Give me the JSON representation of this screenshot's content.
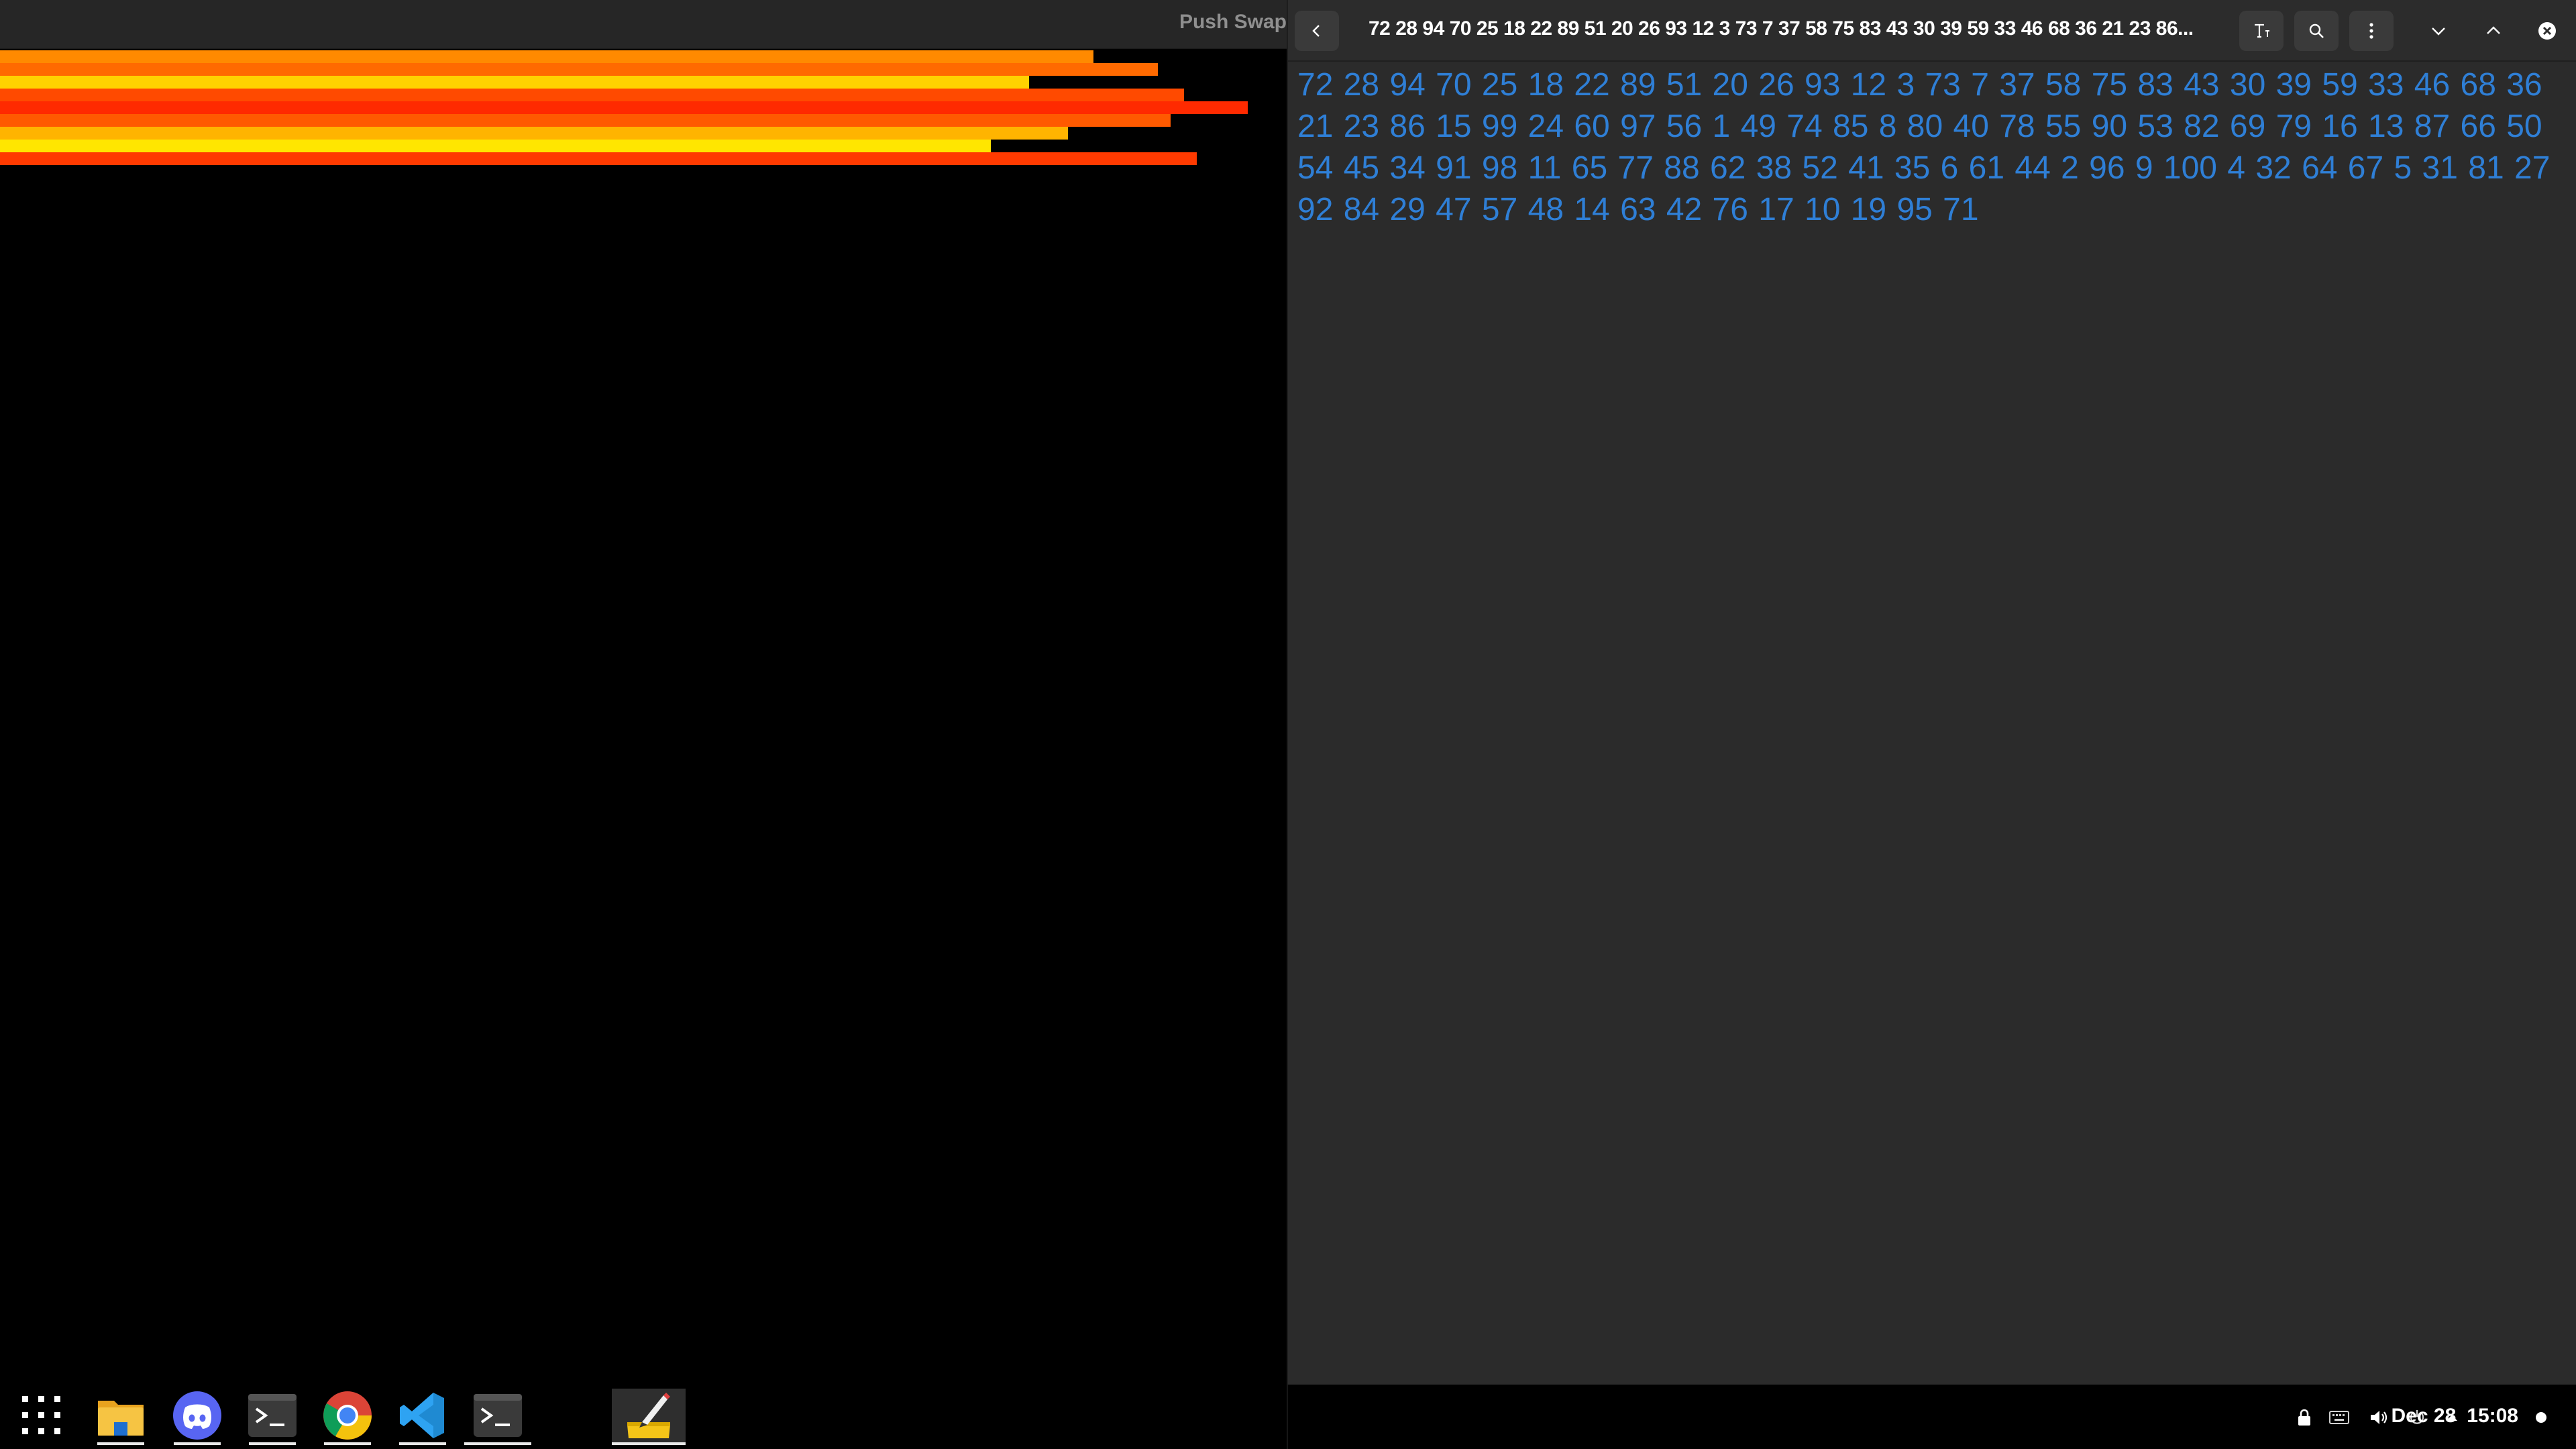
{
  "left_window": {
    "title": "Push Swap",
    "bars": [
      {
        "value": 85,
        "color": "#ff8a00"
      },
      {
        "value": 90,
        "color": "#ff6a00"
      },
      {
        "value": 80,
        "color": "#ffd200"
      },
      {
        "value": 92,
        "color": "#ff4a00"
      },
      {
        "value": 97,
        "color": "#ff2a00"
      },
      {
        "value": 91,
        "color": "#ff5a00"
      },
      {
        "value": 83,
        "color": "#ffb400"
      },
      {
        "value": 77,
        "color": "#ffe600"
      },
      {
        "value": 93,
        "color": "#ff3a00"
      }
    ]
  },
  "editor": {
    "title": "72 28 94 70 25 18 22 89 51 20 26 93 12 3 73 7 37 58 75 83 43 30 39 59 33 46 68 36 21 23 86...",
    "text": "72 28 94 70 25 18 22 89 51 20 26 93 12 3 73 7 37 58 75 83 43 30 39 59 33 46 68 36 21 23 86 15 99 24 60 97 56 1 49 74 85 8 80 40 78 55 90 53 82 69 79 16 13 87 66 50 54 45 34 91 98 11 65 77 88 62 38 52 41 35 6 61 44 2 96 9 100 4 32 64 67 5 31 81 27 92 84 29 47 57 48 14 63 42 76 17 10 19 95 71",
    "text_color": "#2f7fd6",
    "icons": {
      "back": "chevron-left-icon",
      "font": "text-size-icon",
      "search": "search-icon",
      "menu": "kebab-menu-icon",
      "down": "chevron-down-icon",
      "up": "chevron-up-icon",
      "close": "close-icon"
    }
  },
  "taskbar": {
    "apps": [
      {
        "name": "app-grid",
        "icon": "app-grid-icon"
      },
      {
        "name": "files",
        "icon": "folder-icon"
      },
      {
        "name": "discord",
        "icon": "discord-icon"
      },
      {
        "name": "terminal",
        "icon": "terminal-icon"
      },
      {
        "name": "chrome",
        "icon": "chrome-icon"
      },
      {
        "name": "vscode",
        "icon": "vscode-icon"
      },
      {
        "name": "terminal-2",
        "icon": "terminal-icon"
      },
      {
        "name": "text-editor",
        "icon": "text-editor-icon"
      }
    ],
    "tray": {
      "lock": "lock-icon",
      "keyboard": "keyboard-icon",
      "volume": "volume-icon",
      "power": "power-icon",
      "expand": "caret-up-icon"
    },
    "date": "Dec 28",
    "time": "15:08"
  }
}
